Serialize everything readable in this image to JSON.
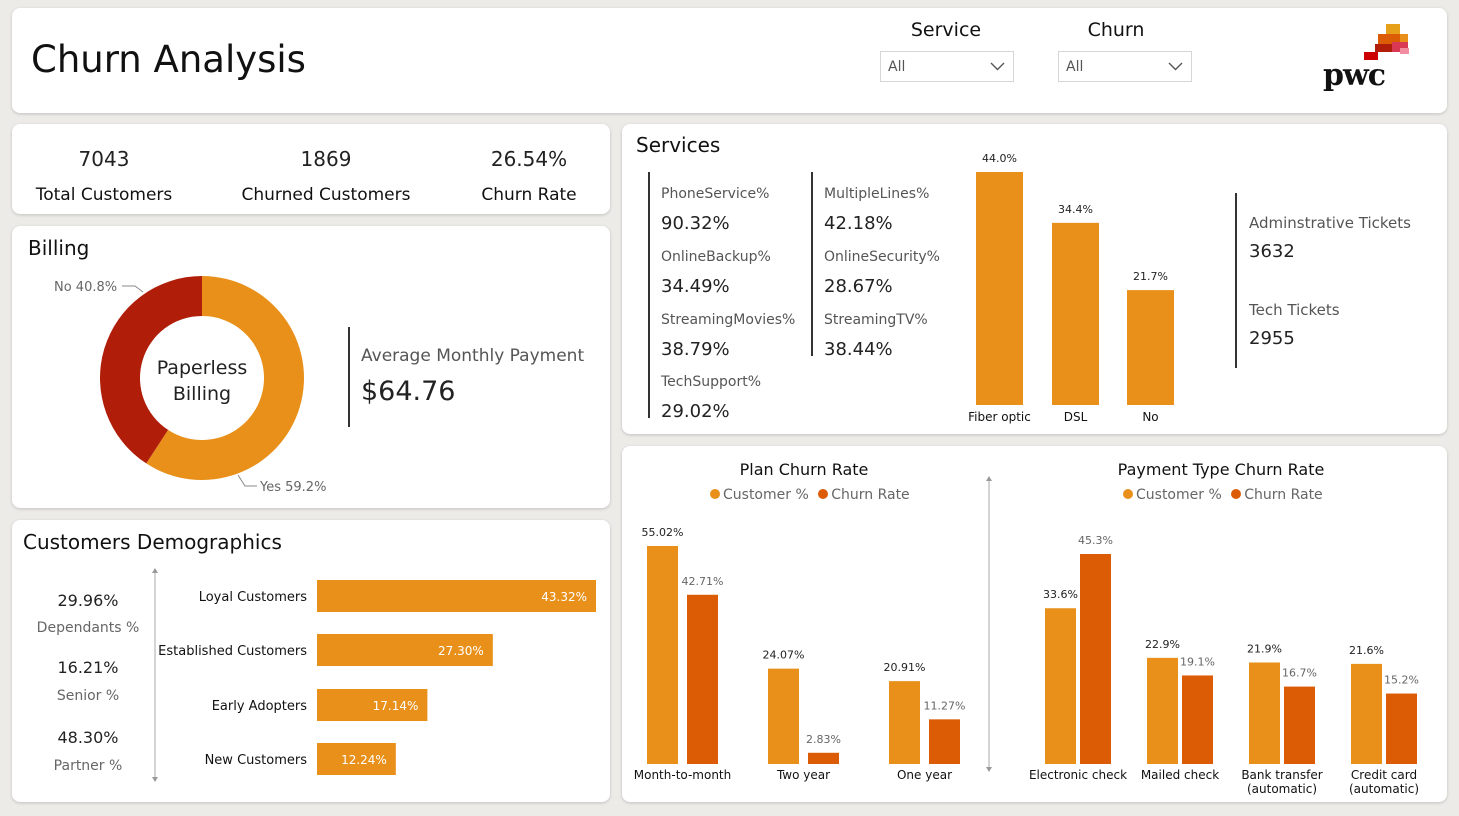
{
  "header": {
    "title": "Churn Analysis",
    "filters": [
      {
        "label": "Service",
        "value": "All"
      },
      {
        "label": "Churn",
        "value": "All"
      }
    ],
    "logo_text": "pwc"
  },
  "kpis": [
    {
      "value": "7043",
      "label": "Total Customers"
    },
    {
      "value": "1869",
      "label": "Churned Customers"
    },
    {
      "value": "26.54%",
      "label": "Churn Rate"
    }
  ],
  "billing": {
    "title": "Billing",
    "donut_center": [
      "Paperless",
      "Billing"
    ],
    "slices": [
      {
        "label": "Yes 59.2%",
        "value": 59.2,
        "color": "#e8901a"
      },
      {
        "label": "No 40.8%",
        "value": 40.8,
        "color": "#b01e0a"
      }
    ],
    "avg_label": "Average Monthly Payment",
    "avg_value": "$64.76"
  },
  "demographics": {
    "title": "Customers Demographics",
    "stats": [
      {
        "value": "29.96%",
        "label": "Dependants %"
      },
      {
        "value": "16.21%",
        "label": "Senior %"
      },
      {
        "value": "48.30%",
        "label": "Partner %"
      }
    ],
    "chart_data": {
      "type": "bar",
      "orientation": "horizontal",
      "categories": [
        "Loyal Customers",
        "Established Customers",
        "Early Adopters",
        "New Customers"
      ],
      "values": [
        43.32,
        27.3,
        17.14,
        12.24
      ],
      "labels": [
        "43.32%",
        "27.30%",
        "17.14%",
        "12.24%"
      ],
      "color": "#e8901a"
    }
  },
  "services": {
    "title": "Services",
    "metrics": [
      {
        "label": "PhoneService%",
        "value": "90.32%"
      },
      {
        "label": "MultipleLines%",
        "value": "42.18%"
      },
      {
        "label": "OnlineBackup%",
        "value": "34.49%"
      },
      {
        "label": "OnlineSecurity%",
        "value": "28.67%"
      },
      {
        "label": "StreamingMovies%",
        "value": "38.79%"
      },
      {
        "label": "StreamingTV%",
        "value": "38.44%"
      },
      {
        "label": "TechSupport%",
        "value": "29.02%"
      }
    ],
    "tickets": [
      {
        "label": "Adminstrative Tickets",
        "value": "3632"
      },
      {
        "label": "Tech Tickets",
        "value": "2955"
      }
    ],
    "chart_data": {
      "type": "bar",
      "categories": [
        "Fiber optic",
        "DSL",
        "No"
      ],
      "values": [
        44.0,
        34.4,
        21.7
      ],
      "labels": [
        "44.0%",
        "34.4%",
        "21.7%"
      ],
      "color": "#e8901a"
    }
  },
  "plan_chart": {
    "title": "Plan Churn Rate",
    "legend": [
      "Customer %",
      "Churn Rate"
    ],
    "chart_data": {
      "type": "bar",
      "categories": [
        "Month-to-month",
        "Two year",
        "One year"
      ],
      "series": [
        {
          "name": "Customer %",
          "values": [
            55.02,
            24.07,
            20.91
          ],
          "labels": [
            "55.02%",
            "24.07%",
            "20.91%"
          ],
          "color": "#e8901a"
        },
        {
          "name": "Churn Rate",
          "values": [
            42.71,
            2.83,
            11.27
          ],
          "labels": [
            "42.71%",
            "2.83%",
            "11.27%"
          ],
          "color": "#dc5b05"
        }
      ]
    }
  },
  "payment_chart": {
    "title": "Payment Type Churn Rate",
    "legend": [
      "Customer %",
      "Churn Rate"
    ],
    "chart_data": {
      "type": "bar",
      "categories": [
        [
          "Electronic check"
        ],
        [
          "Mailed check"
        ],
        [
          "Bank transfer",
          "(automatic)"
        ],
        [
          "Credit card",
          "(automatic)"
        ]
      ],
      "series": [
        {
          "name": "Customer %",
          "values": [
            33.6,
            22.9,
            21.9,
            21.6
          ],
          "labels": [
            "33.6%",
            "22.9%",
            "21.9%",
            "21.6%"
          ],
          "color": "#e8901a"
        },
        {
          "name": "Churn Rate",
          "values": [
            45.3,
            19.1,
            16.7,
            15.2
          ],
          "labels": [
            "45.3%",
            "19.1%",
            "16.7%",
            "15.2%"
          ],
          "color": "#dc5b05"
        }
      ]
    }
  }
}
